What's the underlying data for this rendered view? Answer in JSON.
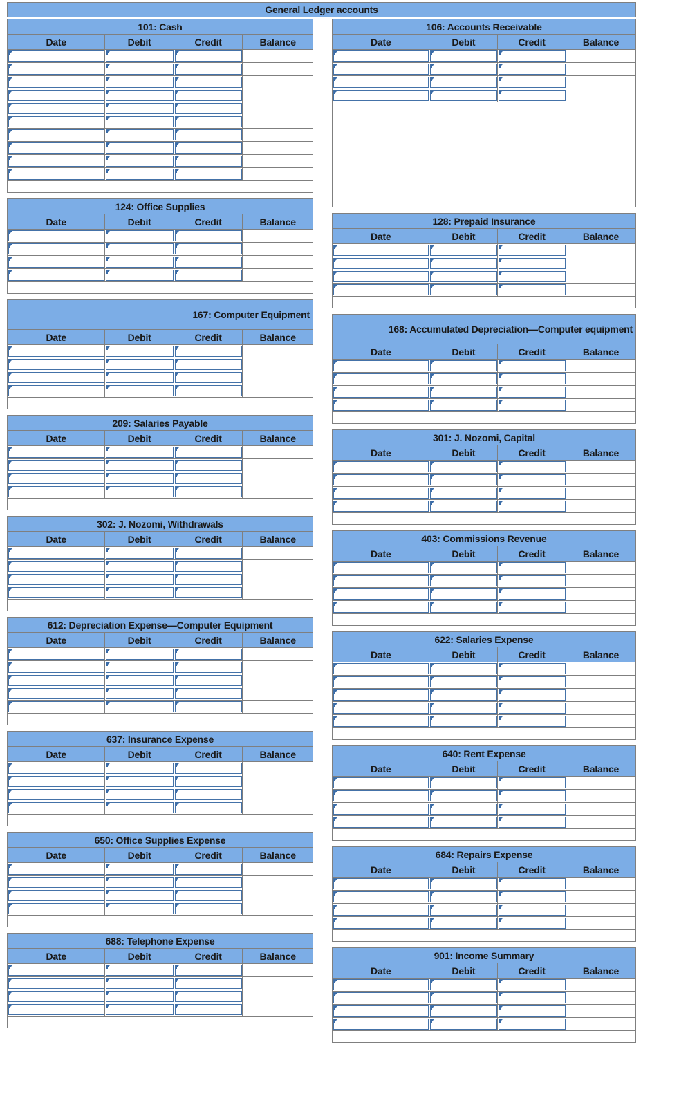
{
  "page": {
    "master_title": "General Ledger accounts",
    "accent_header_color": "#7cade6",
    "cell_border_color": "#4472a8",
    "grid_border_color": "#7f7f7f",
    "text_color": "#1a1a1a"
  },
  "columns": {
    "headers": [
      "Date",
      "Debit",
      "Credit",
      "Balance"
    ]
  },
  "cell_placeholder": "",
  "accounts": {
    "left": [
      {
        "title": "101: Cash",
        "two_line": false,
        "rows": 10,
        "spacer": "normal",
        "data": [
          {
            "date": "",
            "debit": "",
            "credit": "",
            "balance": ""
          },
          {
            "date": "",
            "debit": "",
            "credit": "",
            "balance": ""
          },
          {
            "date": "",
            "debit": "",
            "credit": "",
            "balance": ""
          },
          {
            "date": "",
            "debit": "",
            "credit": "",
            "balance": ""
          },
          {
            "date": "",
            "debit": "",
            "credit": "",
            "balance": ""
          },
          {
            "date": "",
            "debit": "",
            "credit": "",
            "balance": ""
          },
          {
            "date": "",
            "debit": "",
            "credit": "",
            "balance": ""
          },
          {
            "date": "",
            "debit": "",
            "credit": "",
            "balance": ""
          },
          {
            "date": "",
            "debit": "",
            "credit": "",
            "balance": ""
          },
          {
            "date": "",
            "debit": "",
            "credit": "",
            "balance": ""
          }
        ]
      },
      {
        "title": "124: Office Supplies",
        "two_line": false,
        "rows": 4,
        "spacer": "normal",
        "data": [
          {
            "date": "",
            "debit": "",
            "credit": "",
            "balance": ""
          },
          {
            "date": "",
            "debit": "",
            "credit": "",
            "balance": ""
          },
          {
            "date": "",
            "debit": "",
            "credit": "",
            "balance": ""
          },
          {
            "date": "",
            "debit": "",
            "credit": "",
            "balance": ""
          }
        ]
      },
      {
        "title": "167: Computer Equipment",
        "two_line": true,
        "rows": 4,
        "spacer": "normal",
        "data": [
          {
            "date": "",
            "debit": "",
            "credit": "",
            "balance": ""
          },
          {
            "date": "",
            "debit": "",
            "credit": "",
            "balance": ""
          },
          {
            "date": "",
            "debit": "",
            "credit": "",
            "balance": ""
          },
          {
            "date": "",
            "debit": "",
            "credit": "",
            "balance": ""
          }
        ]
      },
      {
        "title": "209: Salaries Payable",
        "two_line": false,
        "rows": 4,
        "spacer": "normal",
        "data": [
          {
            "date": "",
            "debit": "",
            "credit": "",
            "balance": ""
          },
          {
            "date": "",
            "debit": "",
            "credit": "",
            "balance": ""
          },
          {
            "date": "",
            "debit": "",
            "credit": "",
            "balance": ""
          },
          {
            "date": "",
            "debit": "",
            "credit": "",
            "balance": ""
          }
        ]
      },
      {
        "title": "302: J. Nozomi, Withdrawals",
        "two_line": false,
        "rows": 4,
        "spacer": "normal",
        "data": [
          {
            "date": "",
            "debit": "",
            "credit": "",
            "balance": ""
          },
          {
            "date": "",
            "debit": "",
            "credit": "",
            "balance": ""
          },
          {
            "date": "",
            "debit": "",
            "credit": "",
            "balance": ""
          },
          {
            "date": "",
            "debit": "",
            "credit": "",
            "balance": ""
          }
        ]
      },
      {
        "title": "612: Depreciation Expense—Computer Equipment",
        "two_line": false,
        "rows": 5,
        "spacer": "normal",
        "data": [
          {
            "date": "",
            "debit": "",
            "credit": "",
            "balance": ""
          },
          {
            "date": "",
            "debit": "",
            "credit": "",
            "balance": ""
          },
          {
            "date": "",
            "debit": "",
            "credit": "",
            "balance": ""
          },
          {
            "date": "",
            "debit": "",
            "credit": "",
            "balance": ""
          },
          {
            "date": "",
            "debit": "",
            "credit": "",
            "balance": ""
          }
        ]
      },
      {
        "title": "637: Insurance Expense",
        "two_line": false,
        "rows": 4,
        "spacer": "normal",
        "data": [
          {
            "date": "",
            "debit": "",
            "credit": "",
            "balance": ""
          },
          {
            "date": "",
            "debit": "",
            "credit": "",
            "balance": ""
          },
          {
            "date": "",
            "debit": "",
            "credit": "",
            "balance": ""
          },
          {
            "date": "",
            "debit": "",
            "credit": "",
            "balance": ""
          }
        ]
      },
      {
        "title": "650: Office Supplies Expense",
        "two_line": false,
        "rows": 4,
        "spacer": "normal",
        "data": [
          {
            "date": "",
            "debit": "",
            "credit": "",
            "balance": ""
          },
          {
            "date": "",
            "debit": "",
            "credit": "",
            "balance": ""
          },
          {
            "date": "",
            "debit": "",
            "credit": "",
            "balance": ""
          },
          {
            "date": "",
            "debit": "",
            "credit": "",
            "balance": ""
          }
        ]
      },
      {
        "title": "688: Telephone Expense",
        "two_line": false,
        "rows": 4,
        "spacer": "normal",
        "data": [
          {
            "date": "",
            "debit": "",
            "credit": "",
            "balance": ""
          },
          {
            "date": "",
            "debit": "",
            "credit": "",
            "balance": ""
          },
          {
            "date": "",
            "debit": "",
            "credit": "",
            "balance": ""
          },
          {
            "date": "",
            "debit": "",
            "credit": "",
            "balance": ""
          }
        ]
      }
    ],
    "right": [
      {
        "title": "106: Accounts Receivable",
        "two_line": false,
        "rows": 4,
        "spacer": "tall",
        "data": [
          {
            "date": "",
            "debit": "",
            "credit": "",
            "balance": ""
          },
          {
            "date": "",
            "debit": "",
            "credit": "",
            "balance": ""
          },
          {
            "date": "",
            "debit": "",
            "credit": "",
            "balance": ""
          },
          {
            "date": "",
            "debit": "",
            "credit": "",
            "balance": ""
          }
        ]
      },
      {
        "title": "128: Prepaid Insurance",
        "two_line": false,
        "rows": 4,
        "spacer": "normal",
        "data": [
          {
            "date": "",
            "debit": "",
            "credit": "",
            "balance": ""
          },
          {
            "date": "",
            "debit": "",
            "credit": "",
            "balance": ""
          },
          {
            "date": "",
            "debit": "",
            "credit": "",
            "balance": ""
          },
          {
            "date": "",
            "debit": "",
            "credit": "",
            "balance": ""
          }
        ]
      },
      {
        "title": "168: Accumulated Depreciation—Computer equipment",
        "two_line": true,
        "rows": 4,
        "spacer": "normal",
        "data": [
          {
            "date": "",
            "debit": "",
            "credit": "",
            "balance": ""
          },
          {
            "date": "",
            "debit": "",
            "credit": "",
            "balance": ""
          },
          {
            "date": "",
            "debit": "",
            "credit": "",
            "balance": ""
          },
          {
            "date": "",
            "debit": "",
            "credit": "",
            "balance": ""
          }
        ]
      },
      {
        "title": "301: J. Nozomi, Capital",
        "two_line": false,
        "rows": 4,
        "spacer": "normal",
        "data": [
          {
            "date": "",
            "debit": "",
            "credit": "",
            "balance": ""
          },
          {
            "date": "",
            "debit": "",
            "credit": "",
            "balance": ""
          },
          {
            "date": "",
            "debit": "",
            "credit": "",
            "balance": ""
          },
          {
            "date": "",
            "debit": "",
            "credit": "",
            "balance": ""
          }
        ]
      },
      {
        "title": "403: Commissions Revenue",
        "two_line": false,
        "rows": 4,
        "spacer": "normal",
        "data": [
          {
            "date": "",
            "debit": "",
            "credit": "",
            "balance": ""
          },
          {
            "date": "",
            "debit": "",
            "credit": "",
            "balance": ""
          },
          {
            "date": "",
            "debit": "",
            "credit": "",
            "balance": ""
          },
          {
            "date": "",
            "debit": "",
            "credit": "",
            "balance": ""
          }
        ]
      },
      {
        "title": "622: Salaries Expense",
        "two_line": false,
        "rows": 5,
        "spacer": "normal",
        "data": [
          {
            "date": "",
            "debit": "",
            "credit": "",
            "balance": ""
          },
          {
            "date": "",
            "debit": "",
            "credit": "",
            "balance": ""
          },
          {
            "date": "",
            "debit": "",
            "credit": "",
            "balance": ""
          },
          {
            "date": "",
            "debit": "",
            "credit": "",
            "balance": ""
          },
          {
            "date": "",
            "debit": "",
            "credit": "",
            "balance": ""
          }
        ]
      },
      {
        "title": "640: Rent Expense",
        "two_line": false,
        "rows": 4,
        "spacer": "normal",
        "data": [
          {
            "date": "",
            "debit": "",
            "credit": "",
            "balance": ""
          },
          {
            "date": "",
            "debit": "",
            "credit": "",
            "balance": ""
          },
          {
            "date": "",
            "debit": "",
            "credit": "",
            "balance": ""
          },
          {
            "date": "",
            "debit": "",
            "credit": "",
            "balance": ""
          }
        ]
      },
      {
        "title": "684: Repairs Expense",
        "two_line": false,
        "rows": 4,
        "spacer": "normal",
        "data": [
          {
            "date": "",
            "debit": "",
            "credit": "",
            "balance": ""
          },
          {
            "date": "",
            "debit": "",
            "credit": "",
            "balance": ""
          },
          {
            "date": "",
            "debit": "",
            "credit": "",
            "balance": ""
          },
          {
            "date": "",
            "debit": "",
            "credit": "",
            "balance": ""
          }
        ]
      },
      {
        "title": "901: Income Summary",
        "two_line": false,
        "rows": 4,
        "spacer": "normal",
        "data": [
          {
            "date": "",
            "debit": "",
            "credit": "",
            "balance": ""
          },
          {
            "date": "",
            "debit": "",
            "credit": "",
            "balance": ""
          },
          {
            "date": "",
            "debit": "",
            "credit": "",
            "balance": ""
          },
          {
            "date": "",
            "debit": "",
            "credit": "",
            "balance": ""
          }
        ]
      }
    ]
  }
}
